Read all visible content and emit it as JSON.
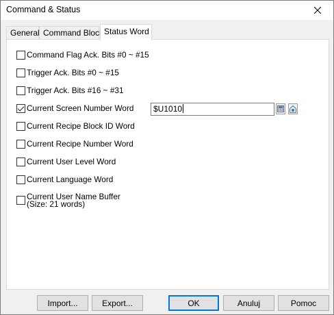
{
  "window": {
    "title": "Command & Status"
  },
  "tabs": [
    {
      "label": "General"
    },
    {
      "label": "Command Block"
    },
    {
      "label": "Status Word",
      "active": true
    }
  ],
  "options": [
    {
      "label": "Command Flag Ack. Bits #0 ~ #15",
      "checked": false
    },
    {
      "label": "Trigger Ack. Bits #0 ~ #15",
      "checked": false
    },
    {
      "label": "Trigger Ack. Bits #16 ~ #31",
      "checked": false
    },
    {
      "label": "Current Screen Number Word",
      "checked": true
    },
    {
      "label": "Current Recipe Block ID Word",
      "checked": false
    },
    {
      "label": "Current Recipe Number Word",
      "checked": false
    },
    {
      "label": "Current User Level Word",
      "checked": false
    },
    {
      "label": "Current Language Word",
      "checked": false
    },
    {
      "label": "Current User Name Buffer",
      "sublabel": "(Size: 21 words)",
      "checked": false
    }
  ],
  "screen_number_address": {
    "value": "$U1010"
  },
  "buttons": {
    "import": "Import...",
    "export": "Export...",
    "ok": "OK",
    "cancel": "Anuluj",
    "help": "Pomoc"
  },
  "colors": {
    "accent": "#0078d7"
  },
  "icons": [
    "close-icon",
    "address-keypad-icon",
    "address-tag-icon"
  ]
}
